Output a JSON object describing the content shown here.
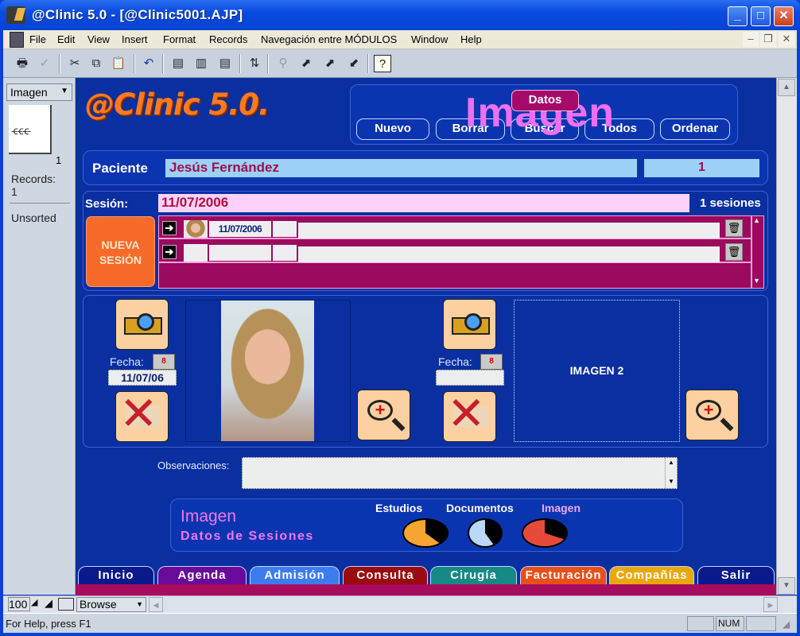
{
  "window": {
    "title": "@Clinic 5.0 - [@Clinic5001.AJP]"
  },
  "menu": [
    "File",
    "Edit",
    "View",
    "Insert",
    "Format",
    "Records",
    "Navegación entre MÓDULOS",
    "Window",
    "Help"
  ],
  "toolbar": {
    "icons": [
      "print-icon",
      "spellcheck-icon",
      "cut-icon",
      "copy-icon",
      "paste-icon",
      "undo-icon",
      "new-record-icon",
      "duplicate-record-icon",
      "delete-record-icon",
      "sort-icon",
      "find-icon",
      "nav-first-icon",
      "nav-next-icon",
      "nav-back-icon",
      "help-icon"
    ]
  },
  "left_panel": {
    "form_selector": "Imagen",
    "record_number": "1",
    "records_label": "Records:",
    "records_count": "1",
    "sort_status": "Unsorted"
  },
  "header": {
    "logo": "@Clinic 5.0.",
    "module_title": "Imagen",
    "datos_button": "Datos",
    "actions": [
      "Nuevo",
      "Borrar",
      "Buscar",
      "Todos",
      "Ordenar"
    ]
  },
  "patient": {
    "label": "Paciente",
    "name": "Jesús Fernández",
    "number": "1"
  },
  "session": {
    "label": "Sesión:",
    "date": "11/07/2006",
    "count_text": "1 sesiones",
    "new_button": "NUEVA SESIÓN",
    "rows": [
      {
        "date": "11/07/2006",
        "has_thumb": true
      },
      {
        "date": "",
        "has_thumb": false
      }
    ]
  },
  "images": {
    "fecha_label": "Fecha:",
    "image1_date": "11/07/06",
    "image2_date": "",
    "image2_placeholder": "IMAGEN 2"
  },
  "observations": {
    "label": "Observaciones:",
    "value": ""
  },
  "module_panel": {
    "title": "Imagen",
    "subtitle": "Datos de Sesiones",
    "links": [
      {
        "label": "Estudios",
        "color": "#ffffff",
        "icon_color": "#f5a530"
      },
      {
        "label": "Documentos",
        "color": "#ffffff",
        "icon_color": "#b8d8f5"
      },
      {
        "label": "Imagen",
        "color": "#f0a8f0",
        "icon_color": "#e84a3a"
      }
    ]
  },
  "tabs": [
    {
      "label": "Inicio",
      "color": "#0a1a8a",
      "text": "#ffffff"
    },
    {
      "label": "Agenda",
      "color": "#6a0a9a",
      "text": "#ffffff"
    },
    {
      "label": "Admisión",
      "color": "#3c7cf0",
      "text": "#ffffff"
    },
    {
      "label": "Consulta",
      "color": "#9a0a10",
      "text": "#ffffff"
    },
    {
      "label": "Cirugía",
      "color": "#158a85",
      "text": "#ffffff"
    },
    {
      "label": "Facturación",
      "color": "#e8501a",
      "text": "#ffffff"
    },
    {
      "label": "Compañías",
      "color": "#e8a80a",
      "text": "#ffffff"
    },
    {
      "label": "Salir",
      "color": "#0a1a8a",
      "text": "#ffffff"
    }
  ],
  "nav": {
    "zoom": "100",
    "mode": "Browse"
  },
  "status": {
    "help": "For Help, press F1",
    "num": "NUM"
  }
}
